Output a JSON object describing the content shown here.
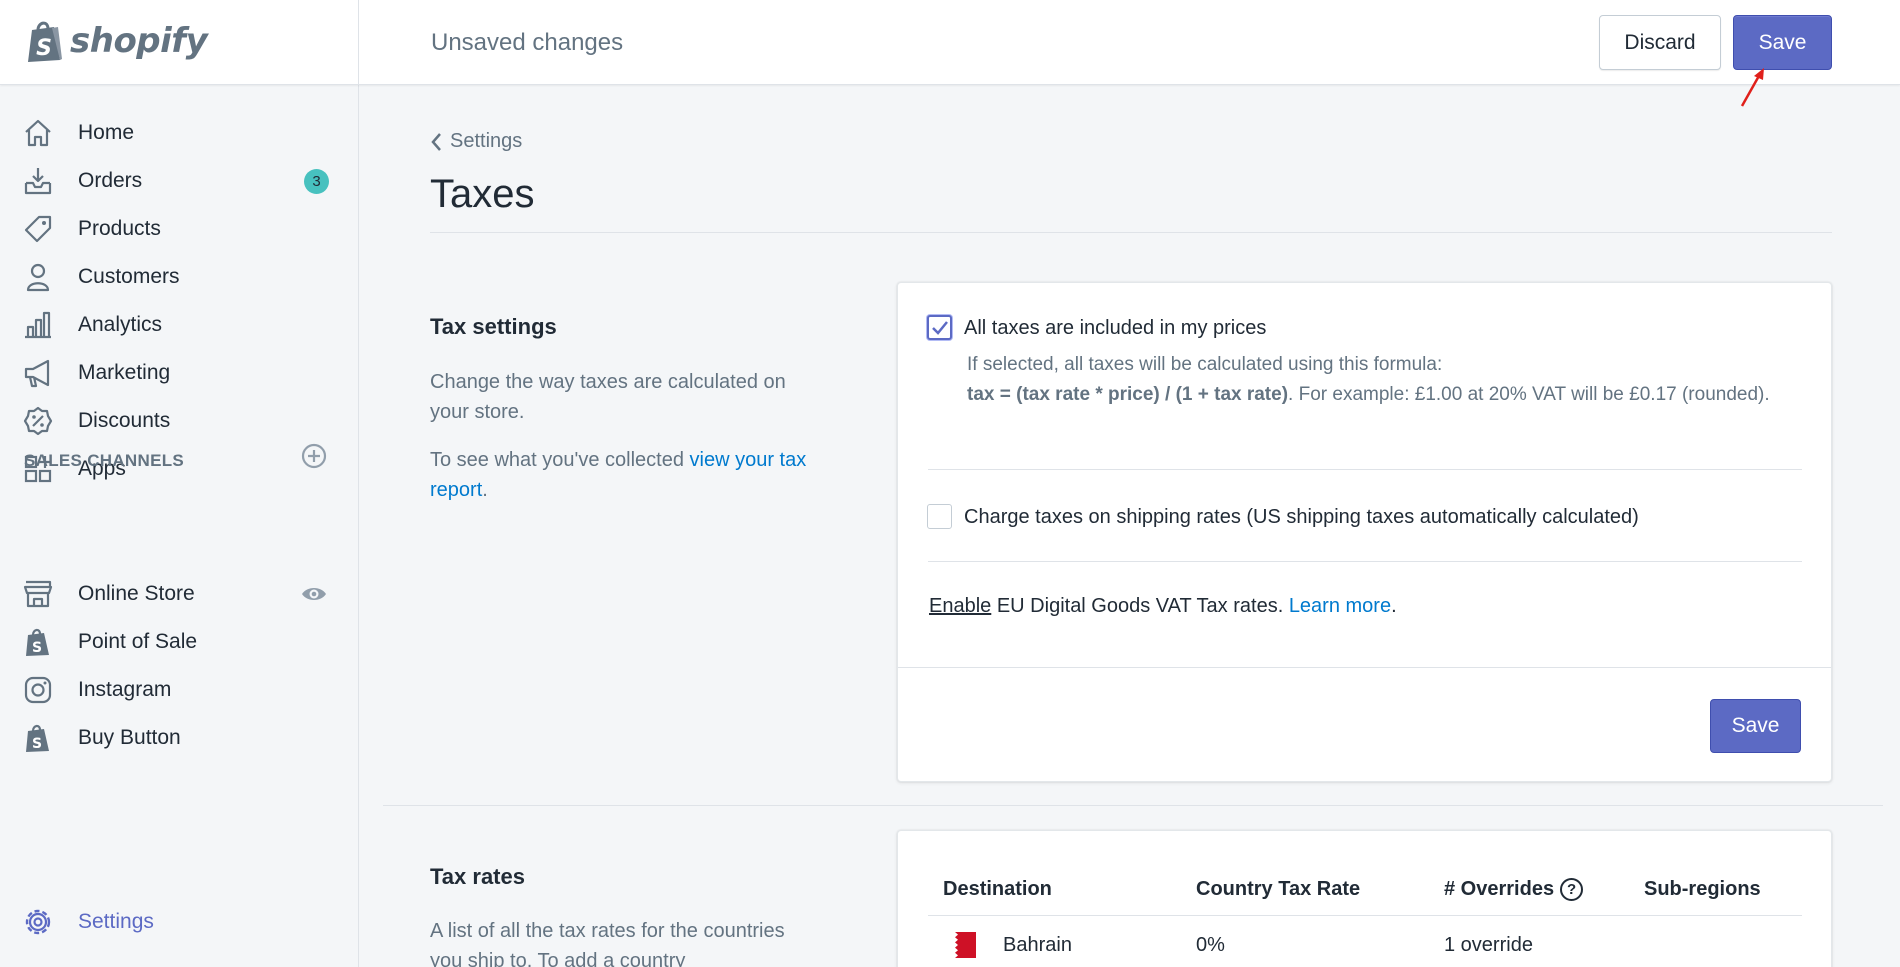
{
  "topbar": {
    "logo_text": "shopify",
    "status": "Unsaved changes",
    "discard_label": "Discard",
    "save_label": "Save"
  },
  "sidebar": {
    "items": [
      {
        "label": "Home",
        "icon": "home-icon"
      },
      {
        "label": "Orders",
        "icon": "orders-icon",
        "badge": "3"
      },
      {
        "label": "Products",
        "icon": "tag-icon"
      },
      {
        "label": "Customers",
        "icon": "person-icon"
      },
      {
        "label": "Analytics",
        "icon": "bar-chart-icon"
      },
      {
        "label": "Marketing",
        "icon": "megaphone-icon"
      },
      {
        "label": "Discounts",
        "icon": "discount-icon"
      },
      {
        "label": "Apps",
        "icon": "apps-icon"
      }
    ],
    "sales_channels_title": "SALES CHANNELS",
    "channels": [
      {
        "label": "Online Store",
        "icon": "store-icon"
      },
      {
        "label": "Point of Sale",
        "icon": "shopify-bag-icon"
      },
      {
        "label": "Instagram",
        "icon": "instagram-icon"
      },
      {
        "label": "Buy Button",
        "icon": "shopify-bag-icon"
      }
    ],
    "settings_label": "Settings"
  },
  "page": {
    "breadcrumb": "Settings",
    "title": "Taxes"
  },
  "tax_settings": {
    "heading": "Tax settings",
    "desc1": "Change the way taxes are calculated on your store.",
    "desc2_prefix": "To see what you've collected ",
    "desc2_link": "view your tax report",
    "desc2_suffix": ".",
    "included_label": "All taxes are included in my prices",
    "included_checked": true,
    "help_line1": "If selected, all taxes will be calculated using this formula:",
    "help_formula": "tax = (tax rate * price) / (1 + tax rate)",
    "help_rest": ". For example: £1.00 at 20% VAT will be £0.17 (rounded).",
    "shipping_label": "Charge taxes on shipping rates (US shipping taxes automatically calculated)",
    "shipping_checked": false,
    "eu_enable": "Enable",
    "eu_text": " EU Digital Goods VAT Tax rates. ",
    "eu_link": "Learn more",
    "eu_suffix": ".",
    "save_label": "Save"
  },
  "tax_rates": {
    "heading": "Tax rates",
    "desc": "A list of all the tax rates for the countries you ship to. To add a country",
    "columns": [
      "Destination",
      "Country Tax Rate",
      "# Overrides",
      "Sub-regions"
    ],
    "overrides_help": "?",
    "rows": [
      {
        "destination": "Bahrain",
        "rate": "0%",
        "overrides": "1 override",
        "subregions": ""
      }
    ]
  },
  "colors": {
    "accent": "#5c6ac4",
    "link": "#007ace",
    "badge": "#47c1bf"
  }
}
